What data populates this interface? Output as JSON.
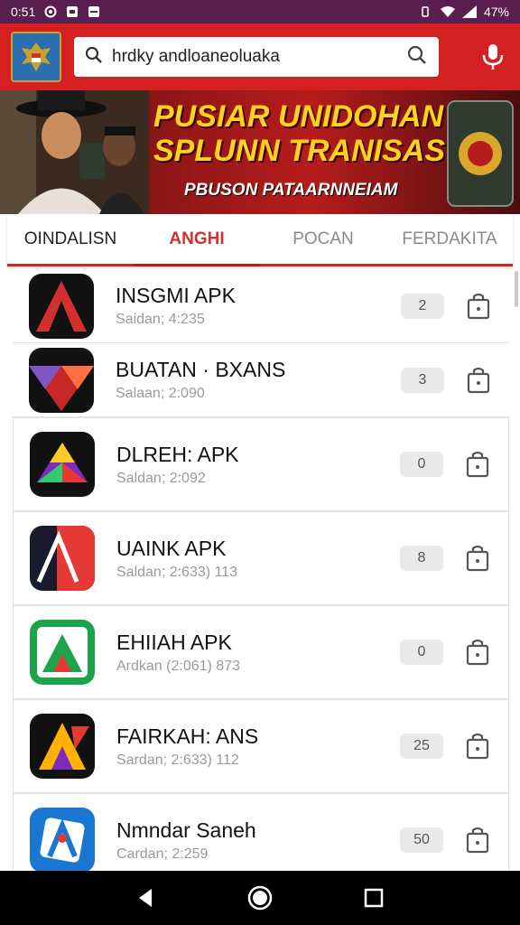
{
  "status_bar": {
    "time": "0:51",
    "battery": "47%"
  },
  "search": {
    "value": "hrdky andloaneoluaka"
  },
  "banner": {
    "line1": "PUSIAR UNIDOHAN",
    "line2": "SPLUNN TRANISAS",
    "line3": "PBUSON PATAARNNEIAM"
  },
  "tabs": [
    {
      "label": "OINDALISN"
    },
    {
      "label": "ANGHI"
    },
    {
      "label": "POCAN"
    },
    {
      "label": "FERDAKITA"
    }
  ],
  "apps": [
    {
      "name": "INSGMI APK",
      "meta": "Saidan; 4:235",
      "count": "2",
      "accent": "#d32f2f"
    },
    {
      "name": "BUATAN · BXANS",
      "meta": "Salaan; 2:090",
      "count": "3",
      "accent": "#c62828"
    },
    {
      "name": "DLREH: APK",
      "meta": "Saldan; 2:092",
      "count": "0",
      "accent": "#7b2cbf"
    },
    {
      "name": "UAINK APK",
      "meta": "Saldan; 2:633) 113",
      "count": "8",
      "accent": "#e53935"
    },
    {
      "name": "EHIIAH APK",
      "meta": "Ardkan (2:061) 873",
      "count": "0",
      "accent": "#1fa34a"
    },
    {
      "name": "FAIRKAH: ANS",
      "meta": "Sardan; 2:633) 112",
      "count": "25",
      "accent": "#ffb300"
    },
    {
      "name": "Nmndar Saneh",
      "meta": "Cardan; 2:259",
      "count": "50",
      "accent": "#1976d2"
    }
  ]
}
